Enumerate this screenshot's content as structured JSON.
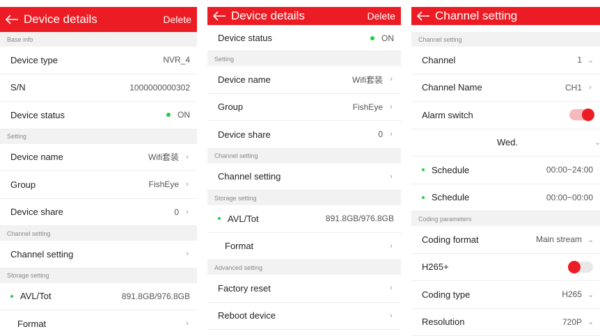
{
  "panel1": {
    "header": {
      "title": "Device details",
      "action": "Delete"
    },
    "sections": {
      "base": "Base info",
      "setting": "Setting",
      "channel": "Channel setting",
      "storage": "Storage setting"
    },
    "rows": {
      "device_type": {
        "label": "Device type",
        "value": "NVR_4"
      },
      "sn": {
        "label": "S/N",
        "value": "1000000000302"
      },
      "device_status": {
        "label": "Device status",
        "value": "ON"
      },
      "device_name": {
        "label": "Device name",
        "value": "Wifi套装"
      },
      "group": {
        "label": "Group",
        "value": "FishEye"
      },
      "device_share": {
        "label": "Device share",
        "value": "0"
      },
      "channel_setting": {
        "label": "Channel setting"
      },
      "avl_tot": {
        "label": "AVL/Tot",
        "value": "891.8GB/976.8GB"
      },
      "format": {
        "label": "Format"
      }
    }
  },
  "panel2": {
    "header": {
      "title": "Device details",
      "action": "Delete"
    },
    "sections": {
      "setting": "Setting",
      "channel": "Channel setting",
      "storage": "Storage setting",
      "advanced": "Advanced setting"
    },
    "rows": {
      "device_status": {
        "label": "Device status",
        "value": "ON"
      },
      "device_name": {
        "label": "Device name",
        "value": "Wifi套装"
      },
      "group": {
        "label": "Group",
        "value": "FishEye"
      },
      "device_share": {
        "label": "Device share",
        "value": "0"
      },
      "channel_setting": {
        "label": "Channel setting"
      },
      "avl_tot": {
        "label": "AVL/Tot",
        "value": "891.8GB/976.8GB"
      },
      "format": {
        "label": "Format"
      },
      "factory_reset": {
        "label": "Factory reset"
      },
      "reboot": {
        "label": "Reboot device"
      }
    }
  },
  "panel3": {
    "header": {
      "title": "Channel setting"
    },
    "sections": {
      "channel": "Channel setting",
      "coding": "Coding parameters"
    },
    "rows": {
      "channel": {
        "label": "Channel",
        "value": "1"
      },
      "channel_name": {
        "label": "Channel Name",
        "value": "CH1"
      },
      "alarm_switch": {
        "label": "Alarm switch",
        "state": "on"
      },
      "day": {
        "label": "Wed."
      },
      "schedule1": {
        "label": "Schedule",
        "value": "00:00~24:00"
      },
      "schedule2": {
        "label": "Schedule",
        "value": "00:00~00:00"
      },
      "coding_format": {
        "label": "Coding format",
        "value": "Main stream"
      },
      "h265plus": {
        "label": "H265+",
        "state": "off"
      },
      "coding_type": {
        "label": "Coding type",
        "value": "H265"
      },
      "resolution": {
        "label": "Resolution",
        "value": "720P"
      }
    }
  },
  "icons": {
    "back": "arrow-left-icon",
    "chevron_right": "chevron-right-icon",
    "chevron_down": "chevron-down-icon"
  },
  "colors": {
    "brand": "#ec1c24",
    "status_on": "#22cc44",
    "section_bg": "#f2f2f2"
  }
}
